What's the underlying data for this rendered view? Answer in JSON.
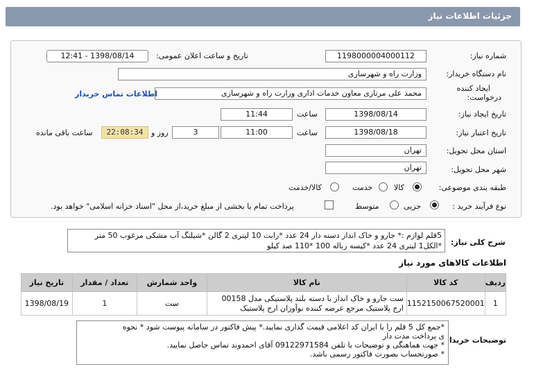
{
  "header": {
    "title": "جزئیات اطلاعات نیاز"
  },
  "form": {
    "need_number_label": "شماره نیاز:",
    "need_number": "1198000004000112",
    "announce_label": "تاریخ و ساعت اعلان عمومی:",
    "announce_value": "1398/08/14 - 12:41",
    "buyer_org_label": "نام دستگاه خریدار:",
    "buyer_org": "وزارت راه و شهرسازی",
    "creator_label_1": "ایجاد کننده",
    "creator_label_2": "درخواست:",
    "creator": "محمد علی  مرتازی معاون خدمات اداری وزارت راه و شهرسازی",
    "contact_link": "اطلاعات تماس خریدار",
    "created_label": "تاریخ ایجاد نیاز:",
    "created_date": "1398/08/14",
    "hour_label": "ساعت",
    "created_time": "11:44",
    "validity_label": "تاریخ اعتبار نیاز:",
    "validity_date": "1398/08/18",
    "validity_time": "11:00",
    "days_value": "3",
    "days_label": "روز و",
    "remaining_time": "22:08:34",
    "remaining_label": "ساعت باقی مانده",
    "province_label": "استان محل تحویل:",
    "province": "تهران",
    "city_label": "شهر محل تحویل:",
    "city": "تهران",
    "category_label": "طبقه بندی موضوعی:",
    "category_options": [
      "کالا",
      "خدمت",
      "کالا/خدمت"
    ],
    "process_label": "نوع فرآیند خرید :",
    "process_options": [
      "جزیی",
      "متوسط"
    ],
    "payment_note": "پرداخت تمام یا بخشی از مبلغ خرید،از محل \"اسناد خزانه اسلامی\" خواهد بود."
  },
  "description": {
    "label": "شرح کلی نیاز:",
    "line1": "5قلم لوازم :* جارو و خاک انداز دسته دار 24 عدد *رایت 10 لیتری 2 گالن *شیلنگ آب مشکی مرغوب 50 متر",
    "line2": "*الکل1 لیتری 24 عدد *کیسه زباله 100 *110 صد کیلو"
  },
  "items_section": {
    "title": "اطلاعات کالاهای مورد نیاز",
    "columns": [
      "ردیف",
      "کد کالا",
      "نام کالا",
      "واحد شمارش",
      "تعداد / مقدار",
      "تاریخ نیاز"
    ],
    "rows": [
      {
        "row": "1",
        "code": "1152150067520001",
        "name_line1": "ست جارو و خاک انداز با دسته بلند پلاستیکی مدل 00158",
        "name_line2": "ارج پلاستیک مرجع عرضه کننده نوآوران ارج پلاستیک",
        "unit": "ست",
        "qty": "1",
        "date": "1398/08/19"
      }
    ]
  },
  "notes": {
    "label": "توضیحات خریدار:",
    "line1": "*جمع کل 5 قلم را با ایران کد اعلامی قیمت گذاری نمایید.* پیش فاکتور در سامانه پیوست شود * نحوه",
    "line2": "ی پرداخت مدت دار",
    "line3": "* جهت هماهنگی و توضیحات با تلفن 09122971584 آقای احمدوند تماس حاصل نمایید.",
    "line4": "* صورتحساب بصورت فاکتور رسمی باشد."
  }
}
